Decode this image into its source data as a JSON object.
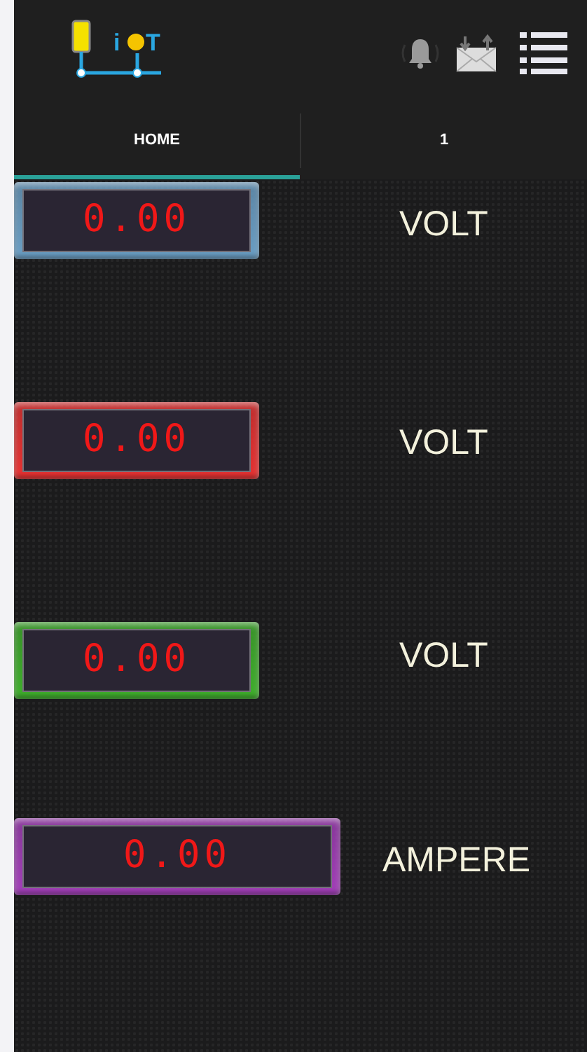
{
  "app_bar": {
    "logo_letters": [
      "i",
      "T"
    ]
  },
  "tabs": [
    {
      "label": "HOME",
      "selected": true
    },
    {
      "label": "1",
      "selected": false
    }
  ],
  "meters": [
    {
      "value": "0.00",
      "unit": "VOLT",
      "color": "#6a9ec4"
    },
    {
      "value": "0.00",
      "unit": "VOLT",
      "color": "#e63232"
    },
    {
      "value": "0.00",
      "unit": "VOLT",
      "color": "#3fae2c"
    },
    {
      "value": "0.00",
      "unit": "AMPERE",
      "color": "#a23fb8"
    }
  ]
}
